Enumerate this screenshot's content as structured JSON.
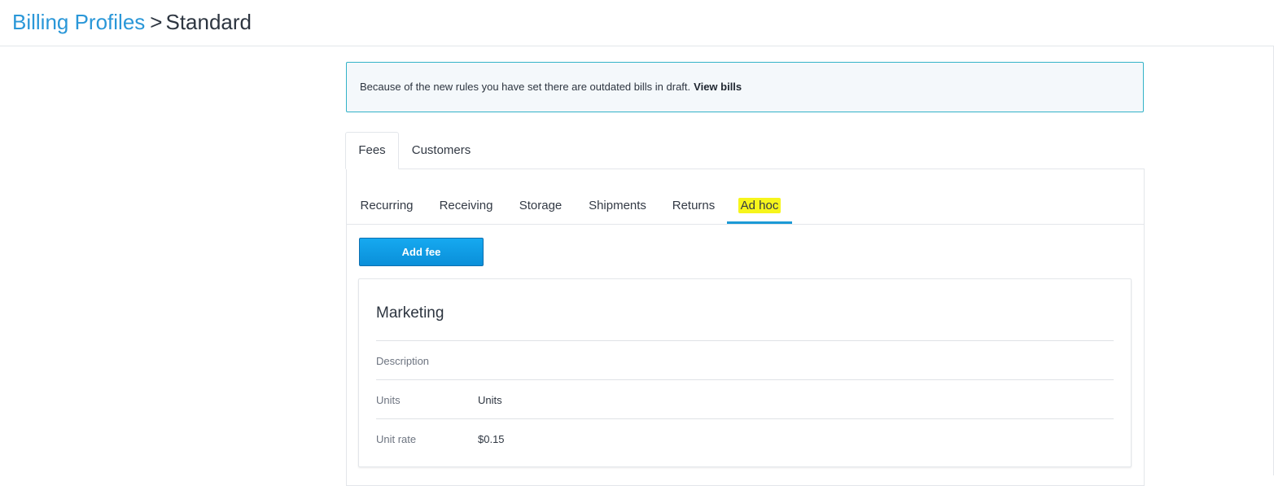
{
  "header": {
    "breadcrumb_link": "Billing Profiles",
    "breadcrumb_sep": ">",
    "breadcrumb_current": "Standard"
  },
  "alert": {
    "message": "Because of the new rules you have set there are outdated bills in draft.",
    "link": "View bills"
  },
  "main_tabs": [
    {
      "label": "Fees",
      "active": true
    },
    {
      "label": "Customers",
      "active": false
    }
  ],
  "sub_tabs": [
    {
      "label": "Recurring",
      "active": false
    },
    {
      "label": "Receiving",
      "active": false
    },
    {
      "label": "Storage",
      "active": false
    },
    {
      "label": "Shipments",
      "active": false
    },
    {
      "label": "Returns",
      "active": false
    },
    {
      "label": "Ad hoc",
      "active": true,
      "highlighted": true
    }
  ],
  "add_fee_label": "Add fee",
  "fee_card": {
    "title": "Marketing",
    "rows": [
      {
        "label": "Description",
        "value": ""
      },
      {
        "label": "Units",
        "value": "Units"
      },
      {
        "label": "Unit rate",
        "value": "$0.15"
      }
    ]
  },
  "colors": {
    "link": "#2a97d8",
    "accent": "#1b9ad6",
    "alert_border": "#33b3c8",
    "highlight": "#f6f51c",
    "button": "#0a8fd9"
  }
}
